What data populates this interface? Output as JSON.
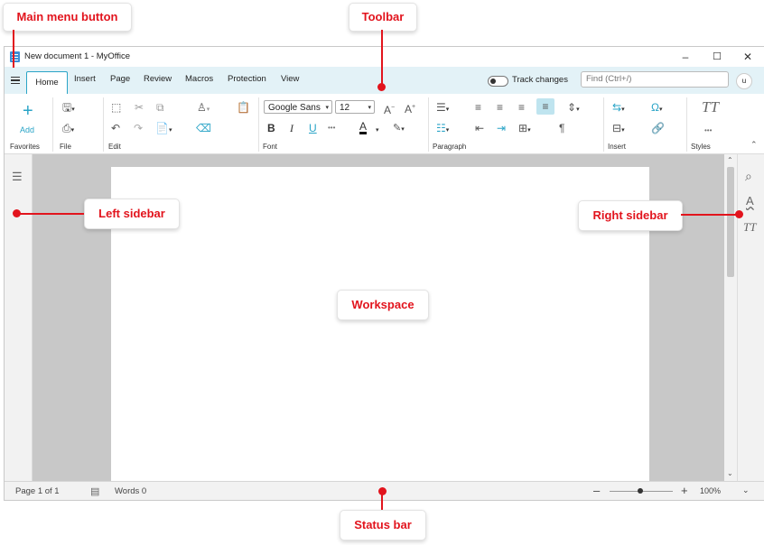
{
  "window": {
    "title": "New document 1 - MyOffice",
    "controls": {
      "minimize": "–",
      "maximize": "☐",
      "close": "✕"
    }
  },
  "tabs": [
    "Home",
    "Insert",
    "Page",
    "Review",
    "Macros",
    "Protection",
    "View"
  ],
  "active_tab": "Home",
  "track_changes": {
    "label": "Track changes",
    "on": false
  },
  "find": {
    "placeholder": "Find (Ctrl+/)"
  },
  "user_initial": "u",
  "ribbon": {
    "favorites": {
      "add_label": "Add",
      "group_label": "Favorites"
    },
    "file": {
      "group_label": "File"
    },
    "edit": {
      "group_label": "Edit"
    },
    "font": {
      "family": "Google Sans",
      "size": "12",
      "group_label": "Font",
      "bold": "B",
      "italic": "I",
      "underline": "U",
      "more": "•••",
      "font_color_glyph": "A"
    },
    "paragraph": {
      "group_label": "Paragraph",
      "pilcrow": "¶"
    },
    "insert": {
      "group_label": "Insert"
    },
    "styles": {
      "group_label": "Styles",
      "icon_text": "TT",
      "more": "•••"
    }
  },
  "status": {
    "page": "Page 1 of 1",
    "words": "Words 0",
    "zoom_out": "–",
    "zoom_in": "+",
    "zoom": "100%",
    "zoom_level": 1.0
  },
  "annotations": {
    "main_menu_button": "Main menu button",
    "toolbar": "Toolbar",
    "left_sidebar": "Left sidebar",
    "right_sidebar": "Right sidebar",
    "workspace": "Workspace",
    "status_bar": "Status bar"
  },
  "colors": {
    "accent": "#2aa4c7",
    "annotation": "#e2141d",
    "tab_bar": "#e3f2f7",
    "workspace": "#c8c8c8"
  }
}
